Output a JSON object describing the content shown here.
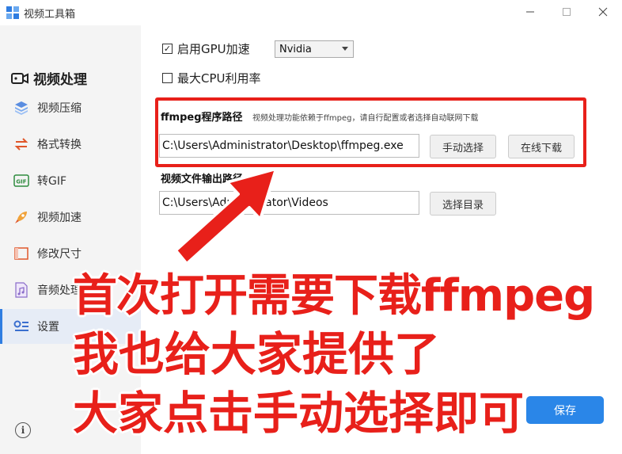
{
  "window": {
    "title": "视频工具箱"
  },
  "sidebar": {
    "section_title": "视频处理",
    "items": [
      {
        "label": "视频压缩",
        "icon": "layers-icon"
      },
      {
        "label": "格式转换",
        "icon": "swap-arrows-icon"
      },
      {
        "label": "转GIF",
        "icon": "gif-icon"
      },
      {
        "label": "视频加速",
        "icon": "rocket-icon"
      },
      {
        "label": "修改尺寸",
        "icon": "resize-icon"
      },
      {
        "label": "音频处理",
        "icon": "music-file-icon"
      },
      {
        "label": "设置",
        "icon": "settings-list-icon",
        "active": true
      }
    ]
  },
  "settings": {
    "gpu_checkbox_label": "启用GPU加速",
    "gpu_checked": true,
    "gpu_vendor": "Nvidia",
    "cpu_checkbox_label": "最大CPU利用率",
    "cpu_checked": false,
    "ffmpeg_title": "ffmpeg程序路径",
    "ffmpeg_hint": "视频处理功能依赖于ffmpeg，请自行配置或者选择自动联网下载",
    "ffmpeg_path": "C:\\Users\\Administrator\\Desktop\\ffmpeg.exe",
    "manual_select_label": "手动选择",
    "online_download_label": "在线下载",
    "output_title": "视频文件输出路径",
    "output_path": "C:\\Users\\Administrator\\Videos",
    "choose_dir_label": "选择目录",
    "save_label": "保存"
  },
  "overlay": {
    "line1": "首次打开需要下载ffmpeg",
    "line2": "我也给大家提供了",
    "line3": "大家点击手动选择即可"
  },
  "colors": {
    "accent": "#2a86e8",
    "annotation": "#e8201a",
    "sidebar_bg": "#f4f4f4"
  }
}
